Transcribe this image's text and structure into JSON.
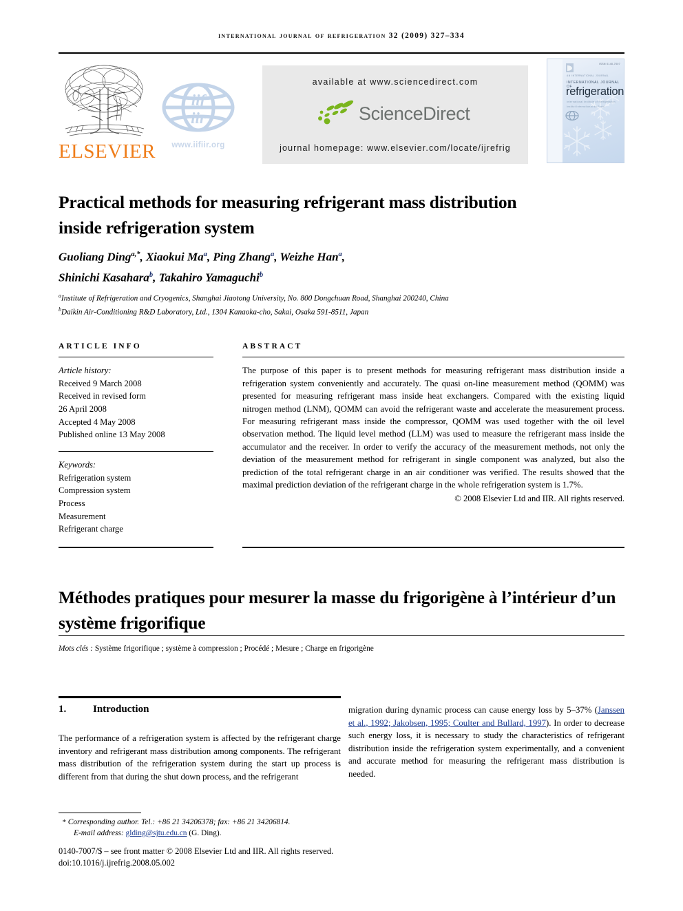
{
  "running_head": "international journal of refrigeration 32 (2009) 327–334",
  "masthead": {
    "elsevier_wordmark": "ELSEVIER",
    "iif_url": "www.iifiir.org",
    "iif_top_text": "iif",
    "iif_bottom_text": "iir",
    "available_at": "available at www.sciencedirect.com",
    "sciencedirect_word": "ScienceDirect",
    "journal_homepage": "journal homepage: www.elsevier.com/locate/ijrefrig",
    "cover": {
      "issn": "ISSN 0140-7007",
      "top_line": "AN INTERNATIONAL JOURNAL",
      "ij_line": "INTERNATIONAL JOURNAL OF",
      "title": "refrigeration",
      "sub1": "International Institute of Refrigeration",
      "sub2": "Institut International du Froid"
    }
  },
  "article": {
    "title": "Practical methods for measuring refrigerant mass distribution inside refrigeration system",
    "authors_line1_pre": "Guoliang Ding",
    "authors_line1_rest": ", Xiaokui Ma",
    "authors_line1_rest2": ", Ping Zhang",
    "authors_line1_rest3": ", Weizhe Han",
    "authors_line2_a": "Shinichi Kasahara",
    "authors_line2_b": ", Takahiro Yamaguchi",
    "sup_a": "a",
    "sup_b": "b",
    "sup_star": ",*",
    "affiliation_a": "Institute of Refrigeration and Cryogenics, Shanghai Jiaotong University, No. 800 Dongchuan Road, Shanghai 200240, China",
    "affiliation_b": "Daikin Air-Conditioning R&D Laboratory, Ltd., 1304 Kanaoka-cho, Sakai, Osaka 591-8511, Japan"
  },
  "article_info": {
    "heading": "ARTICLE INFO",
    "history_label": "Article history:",
    "history": [
      "Received 9 March 2008",
      "Received in revised form",
      "26 April 2008",
      "Accepted 4 May 2008",
      "Published online 13 May 2008"
    ],
    "keywords_label": "Keywords:",
    "keywords": [
      "Refrigeration system",
      "Compression system",
      "Process",
      "Measurement",
      "Refrigerant charge"
    ]
  },
  "abstract": {
    "heading": "ABSTRACT",
    "text": "The purpose of this paper is to present methods for measuring refrigerant mass distribution inside a refrigeration system conveniently and accurately. The quasi on-line measurement method (QOMM) was presented for measuring refrigerant mass inside heat exchangers. Compared with the existing liquid nitrogen method (LNM), QOMM can avoid the refrigerant waste and accelerate the measurement process. For measuring refrigerant mass inside the compressor, QOMM was used together with the oil level observation method. The liquid level method (LLM) was used to measure the refrigerant mass inside the accumulator and the receiver. In order to verify the accuracy of the measurement methods, not only the deviation of the measurement method for refrigerant in single component was analyzed, but also the prediction of the total refrigerant charge in an air conditioner was verified. The results showed that the maximal prediction deviation of the refrigerant charge in the whole refrigeration system is 1.7%.",
    "copyright": "© 2008 Elsevier Ltd and IIR. All rights reserved."
  },
  "french": {
    "title": "Méthodes pratiques pour mesurer la masse du frigorigène à l’intérieur d’un système frigorifique",
    "mots_label": "Mots clés :",
    "mots_value": " Système frigorifique ; système à compression ; Procédé ; Mesure ; Charge en frigorigène"
  },
  "body": {
    "section_number": "1.",
    "section_title": "Introduction",
    "left_column": "The performance of a refrigeration system is affected by the refrigerant charge inventory and refrigerant mass distribution among components. The refrigerant mass distribution of the refrigeration system during the start up process is different from that during the shut down process, and the refrigerant",
    "right_column_pre": "migration during dynamic process can cause energy loss by 5–37% (",
    "right_column_cite": "Janssen et al., 1992; Jakobsen, 1995; Coulter and Bullard, 1997",
    "right_column_post": "). In order to decrease such energy loss, it is necessary to study the characteristics of refrigerant distribution inside the refrigeration system experimentally, and a convenient and accurate method for measuring the refrigerant mass distribution is needed."
  },
  "footer": {
    "corresponding": "Corresponding author. Tel.: +86 21 34206378; fax: +86 21 34206814.",
    "email_label": "E-mail address:",
    "email": "glding@sjtu.edu.cn",
    "email_suffix": "(G. Ding).",
    "issn_line": "0140-7007/$ – see front matter © 2008 Elsevier Ltd and IIR. All rights reserved.",
    "doi": "doi:10.1016/j.ijrefrig.2008.05.002"
  },
  "colors": {
    "elsevier_orange": "#ef7d1a",
    "sciencedirect_green": "#7ab51d",
    "sciencedirect_gray": "#6d7270",
    "link_blue": "#1a3a8f",
    "banner_gray": "#e9e9e9",
    "iif_blue": "#c9d7ea"
  }
}
